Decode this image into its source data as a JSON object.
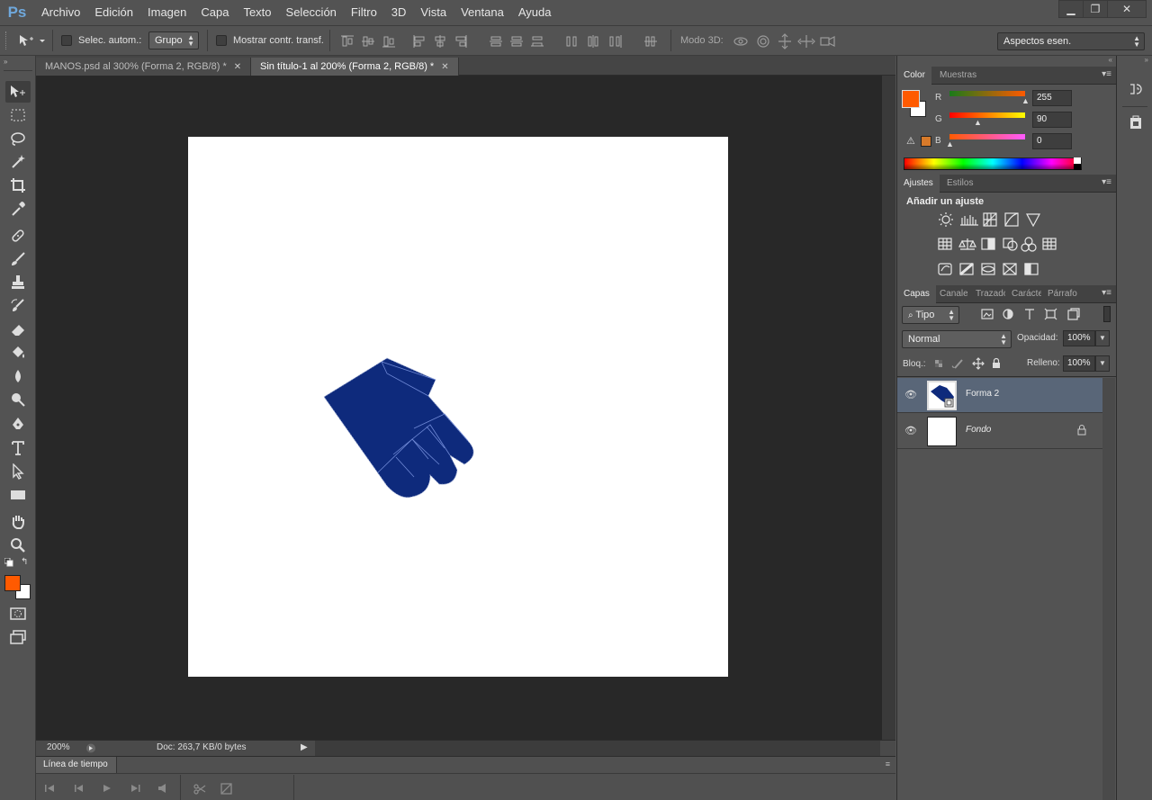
{
  "app": {
    "logo": "Ps"
  },
  "menu": [
    "Archivo",
    "Edición",
    "Imagen",
    "Capa",
    "Texto",
    "Selección",
    "Filtro",
    "3D",
    "Vista",
    "Ventana",
    "Ayuda"
  ],
  "window_controls": {
    "minimize": "▁",
    "restore": "❐",
    "close": "✕"
  },
  "options": {
    "auto_select_label": "Selec. autom.:",
    "auto_select_value": "Grupo",
    "transform_label": "Mostrar contr. transf.",
    "mode3d_label": "Modo 3D:",
    "workspace": "Aspectos esen."
  },
  "tabs": [
    {
      "label": "MANOS.psd al 300% (Forma 2, RGB/8) *",
      "close": "✕"
    },
    {
      "label": "Sin título-1 al 200% (Forma 2, RGB/8) *",
      "close": "✕"
    }
  ],
  "status": {
    "zoom": "200%",
    "doc": "Doc: 263,7 KB/0 bytes"
  },
  "timeline": {
    "title": "Línea de tiempo"
  },
  "color_panel": {
    "tabs": [
      "Color",
      "Muestras"
    ],
    "r_label": "R",
    "g_label": "G",
    "b_label": "B",
    "r": "255",
    "g": "90",
    "b": "0",
    "foreground": "#ff5a00",
    "background": "#ffffff"
  },
  "adjust_panel": {
    "tabs": [
      "Ajustes",
      "Estilos"
    ],
    "title": "Añadir un ajuste"
  },
  "layers_panel": {
    "tabs": [
      "Capas",
      "Canales",
      "Trazados",
      "Carácter",
      "Párrafo"
    ],
    "filter": "Tipo",
    "blend_mode": "Normal",
    "opacity_label": "Opacidad:",
    "opacity": "100%",
    "lock_label": "Bloq.:",
    "fill_label": "Relleno:",
    "fill": "100%",
    "layers": [
      {
        "name": "Forma 2",
        "selected": true
      },
      {
        "name": "Fondo",
        "selected": false,
        "locked": true
      }
    ]
  },
  "colors": {
    "hand": "#0e2a7c",
    "hand_lines": "#6f89d6",
    "ui_bg": "#535353",
    "canvas_bg": "#282828"
  }
}
